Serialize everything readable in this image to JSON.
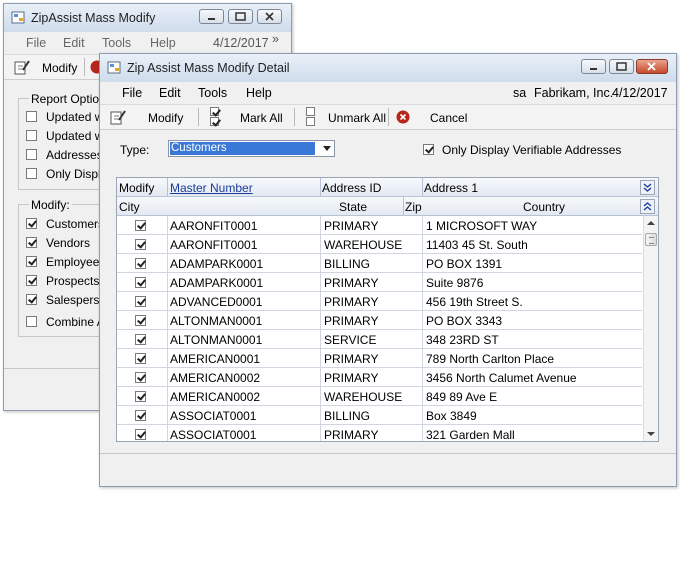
{
  "back_window": {
    "title": "ZipAssist Mass Modify",
    "menu": [
      "File",
      "Edit",
      "Tools",
      "Help"
    ],
    "date": "4/12/2017",
    "overflow": "»",
    "toolbar_modify": "Modify",
    "report_group": "Report Options",
    "report_options": [
      "Updated wi",
      "Updated wi",
      "Addresses i",
      "Only Displa"
    ],
    "modify_group": "Modify:",
    "modify_options": [
      "Customers",
      "Vendors",
      "Employees",
      "Prospects",
      "Salesperso"
    ],
    "combine": "Combine Ac"
  },
  "front_window": {
    "title": "Zip Assist Mass Modify Detail",
    "menu": [
      "File",
      "Edit",
      "Tools",
      "Help"
    ],
    "user": "sa",
    "company": "Fabrikam, Inc.",
    "date": "4/12/2017",
    "toolbar": {
      "modify": "Modify",
      "mark_all": "Mark All",
      "unmark_all": "Unmark All",
      "cancel": "Cancel"
    },
    "type_label": "Type:",
    "type_value": "Customers",
    "only_verifiable": "Only Display Verifiable Addresses",
    "columns_row1": [
      "Modify",
      "Master Number",
      "Address ID",
      "Address 1"
    ],
    "columns_row2": [
      "City",
      "State",
      "Zip",
      "Country"
    ],
    "rows": [
      {
        "master": "AARONFIT0001",
        "address_id": "PRIMARY",
        "address1": "1 MICROSOFT WAY"
      },
      {
        "master": "AARONFIT0001",
        "address_id": "WAREHOUSE",
        "address1": "11403 45 St. South"
      },
      {
        "master": "ADAMPARK0001",
        "address_id": "BILLING",
        "address1": "PO BOX 1391"
      },
      {
        "master": "ADAMPARK0001",
        "address_id": "PRIMARY",
        "address1": "Suite 9876"
      },
      {
        "master": "ADVANCED0001",
        "address_id": "PRIMARY",
        "address1": "456 19th Street S."
      },
      {
        "master": "ALTONMAN0001",
        "address_id": "PRIMARY",
        "address1": "PO BOX 3343"
      },
      {
        "master": "ALTONMAN0001",
        "address_id": "SERVICE",
        "address1": "348 23RD ST"
      },
      {
        "master": "AMERICAN0001",
        "address_id": "PRIMARY",
        "address1": "789 North Carlton Place"
      },
      {
        "master": "AMERICAN0002",
        "address_id": "PRIMARY",
        "address1": "3456 North Calumet Avenue"
      },
      {
        "master": "AMERICAN0002",
        "address_id": "WAREHOUSE",
        "address1": "849 89 Ave E"
      },
      {
        "master": "ASSOCIAT0001",
        "address_id": "BILLING",
        "address1": "Box 3849"
      },
      {
        "master": "ASSOCIAT0001",
        "address_id": "PRIMARY",
        "address1": "321 Garden Mall"
      }
    ]
  }
}
